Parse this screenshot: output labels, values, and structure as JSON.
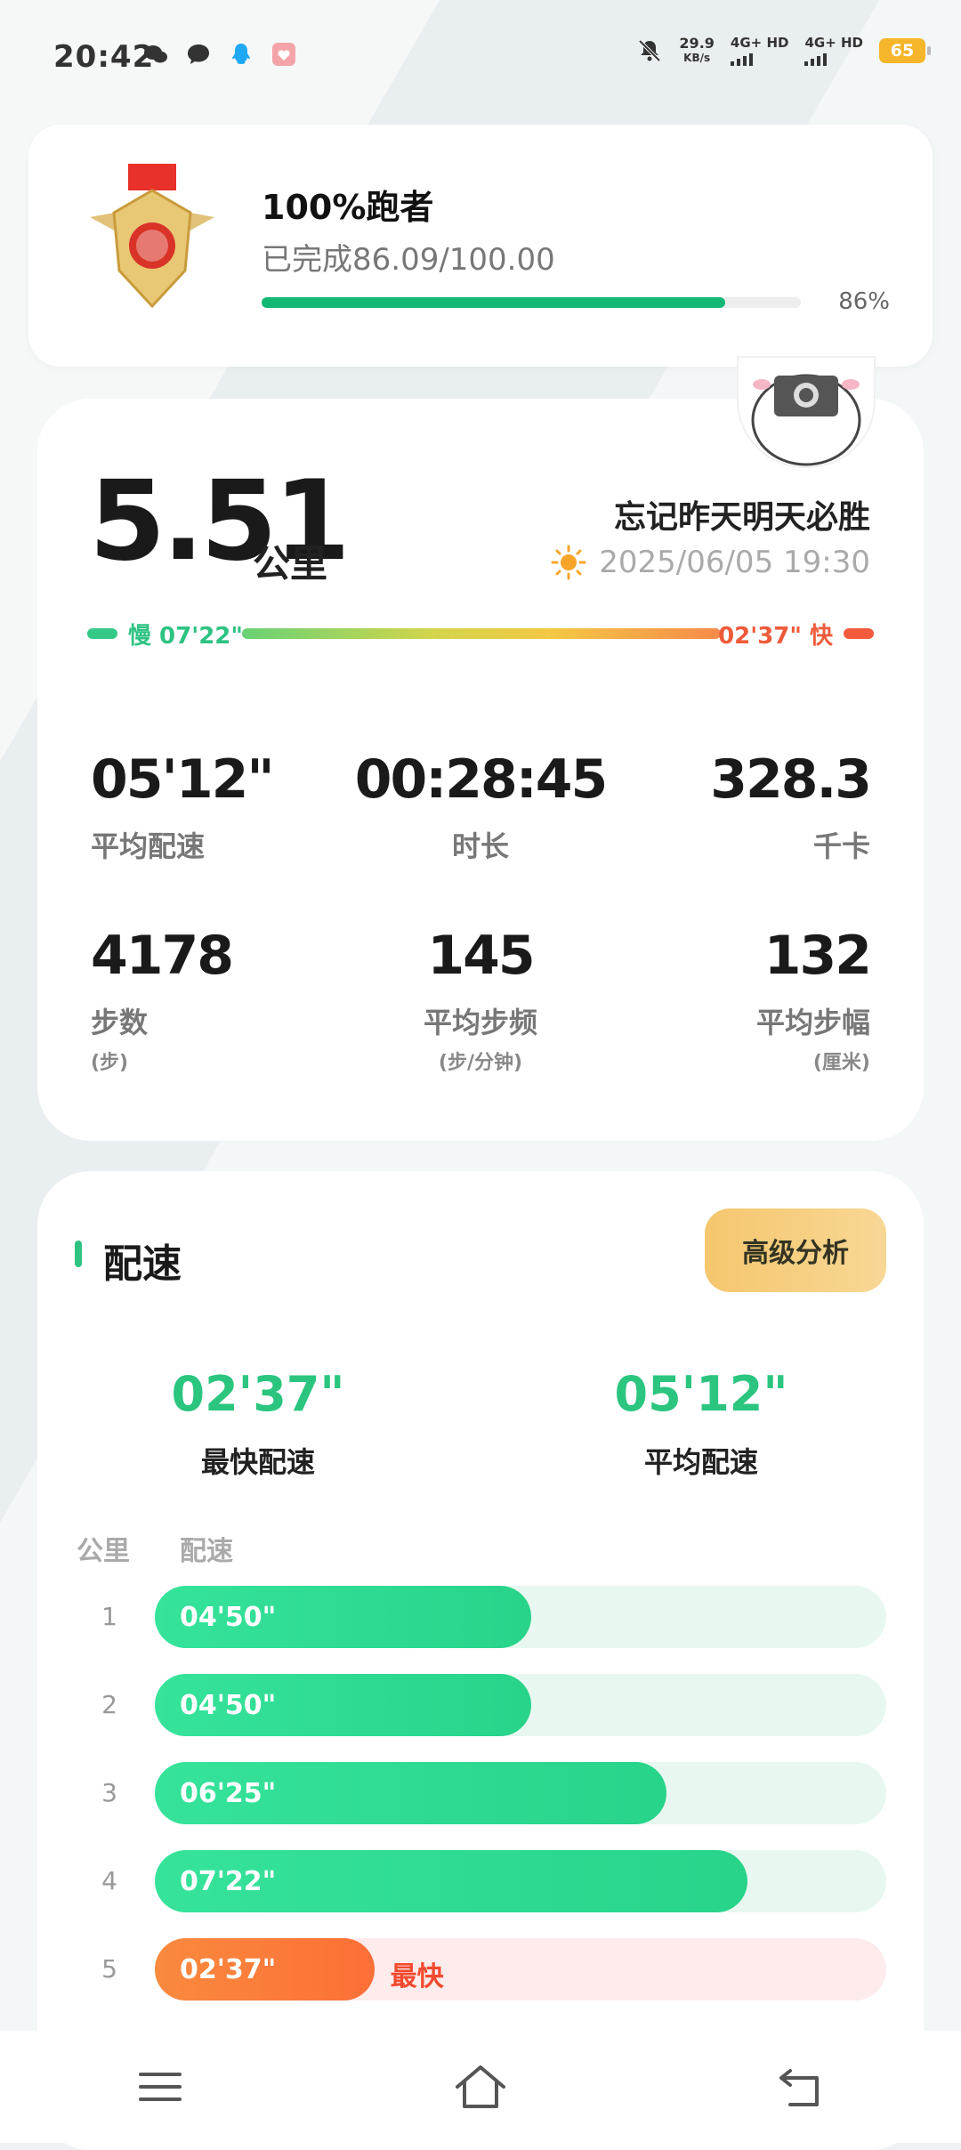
{
  "status_bar": {
    "time": "20:42",
    "speed_value": "29.9",
    "speed_unit": "KB/s",
    "signal1": "4G+ HD",
    "signal2": "4G+ HD",
    "battery": "65",
    "apps": [
      "wechat-icon",
      "message-icon",
      "qq-icon",
      "health-app-icon"
    ]
  },
  "medal": {
    "title": "100%跑者",
    "subtitle": "已完成86.09/100.00",
    "progress": 0.86,
    "percent_text": "86%"
  },
  "run": {
    "distance": "5.51",
    "unit": "公里",
    "name": "忘记昨天明天必胜",
    "datetime": "2025/06/05 19:30",
    "slow_label": "慢 07'22\"",
    "fast_label": "02'37\" 快"
  },
  "stats": [
    {
      "value": "05'12\"",
      "label": "平均配速",
      "unit": ""
    },
    {
      "value": "00:28:45",
      "label": "时长",
      "unit": ""
    },
    {
      "value": "328.3",
      "label": "千卡",
      "unit": ""
    },
    {
      "value": "4178",
      "label": "步数",
      "unit": "(步)"
    },
    {
      "value": "145",
      "label": "平均步频",
      "unit": "(步/分钟)"
    },
    {
      "value": "132",
      "label": "平均步幅",
      "unit": "(厘米)"
    }
  ],
  "pace_section": {
    "title": "配速",
    "advanced_button": "高级分析",
    "fastest_value": "02'37\"",
    "fastest_label": "最快配速",
    "average_value": "05'12\"",
    "average_label": "平均配速",
    "col_km": "公里",
    "col_pace": "配速",
    "best_tag": "最快",
    "rows": [
      {
        "km": "1",
        "pace": "04'50\"",
        "fill": 0.515
      },
      {
        "km": "2",
        "pace": "04'50\"",
        "fill": 0.515
      },
      {
        "km": "3",
        "pace": "06'25\"",
        "fill": 0.7
      },
      {
        "km": "4",
        "pace": "07'22\"",
        "fill": 0.81
      },
      {
        "km": "5",
        "pace": "02'37\"",
        "fill": 0.3,
        "best": true
      }
    ]
  },
  "colors": {
    "accent_green": "#2bc57f",
    "accent_orange": "#fd6f37",
    "gold": "#f5c76e"
  }
}
